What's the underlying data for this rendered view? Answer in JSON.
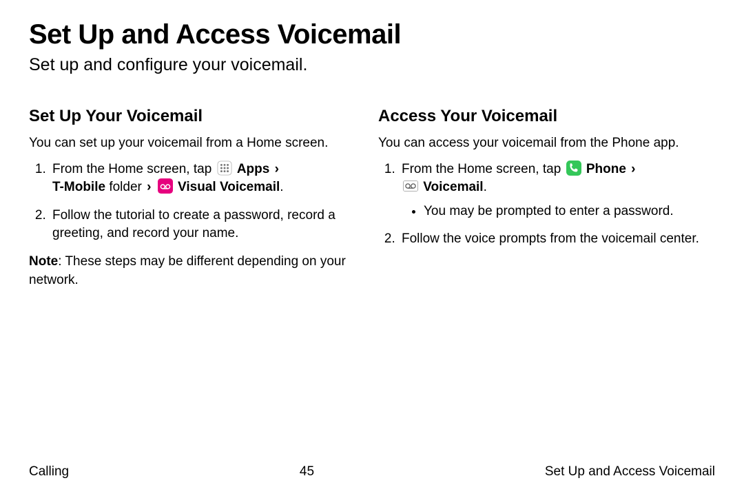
{
  "header": {
    "title": "Set Up and Access Voicemail",
    "subtitle": "Set up and configure your voicemail."
  },
  "left": {
    "heading": "Set Up Your Voicemail",
    "intro": "You can set up your voicemail from a Home screen.",
    "step1": {
      "prefix": "From the Home screen, tap ",
      "apps_label": " Apps",
      "tmobile_label": "T-Mobile",
      "folder_word": " folder ",
      "visual_vm_label": " Visual Voicemail",
      "chevron": "›"
    },
    "step2": "Follow the tutorial to create a password, record a greeting, and record your name.",
    "note_label": "Note",
    "note_body": ": These steps may be different depending on your network."
  },
  "right": {
    "heading": "Access Your Voicemail",
    "intro": "You can access your voicemail from the Phone app.",
    "step1": {
      "prefix": "From the Home screen, tap ",
      "phone_label": " Phone",
      "voicemail_label": " Voicemail",
      "chevron": "›",
      "bullet": "You may be prompted to enter a password."
    },
    "step2": "Follow the voice prompts from the voicemail center."
  },
  "footer": {
    "left": "Calling",
    "center": "45",
    "right": "Set Up and Access Voicemail"
  },
  "icons": {
    "apps": "apps-grid-icon",
    "visual_voicemail": "visual-voicemail-icon",
    "phone": "phone-icon",
    "voicemail_tape": "voicemail-tape-icon"
  },
  "dot": "."
}
